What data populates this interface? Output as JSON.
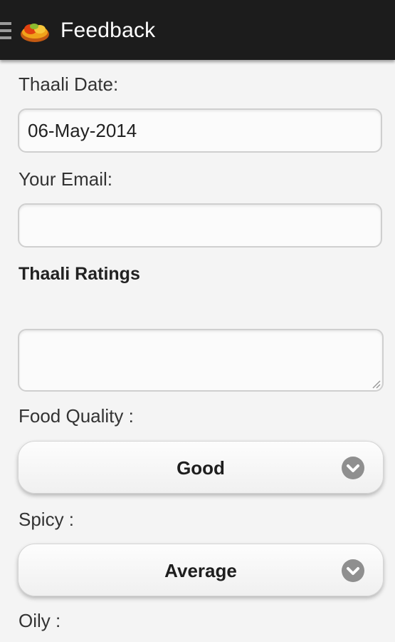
{
  "actionbar": {
    "title": "Feedback",
    "menu_icon": "hamburger-icon",
    "logo_icon": "thaali-logo-icon"
  },
  "form": {
    "thaali_date": {
      "label": "Thaali Date:",
      "value": "06-May-2014"
    },
    "email": {
      "label": "Your Email:",
      "value": ""
    },
    "ratings": {
      "heading": "Thaali Ratings",
      "comment_value": ""
    },
    "food_quality": {
      "label": "Food Quality :",
      "selected": "Good"
    },
    "spicy": {
      "label": "Spicy :",
      "selected": "Average"
    },
    "oily": {
      "label": "Oily :"
    }
  },
  "colors": {
    "actionbar_bg": "#1c1c1c",
    "page_bg": "#f4f4f4",
    "chevron_bg": "#8f8f8f"
  }
}
